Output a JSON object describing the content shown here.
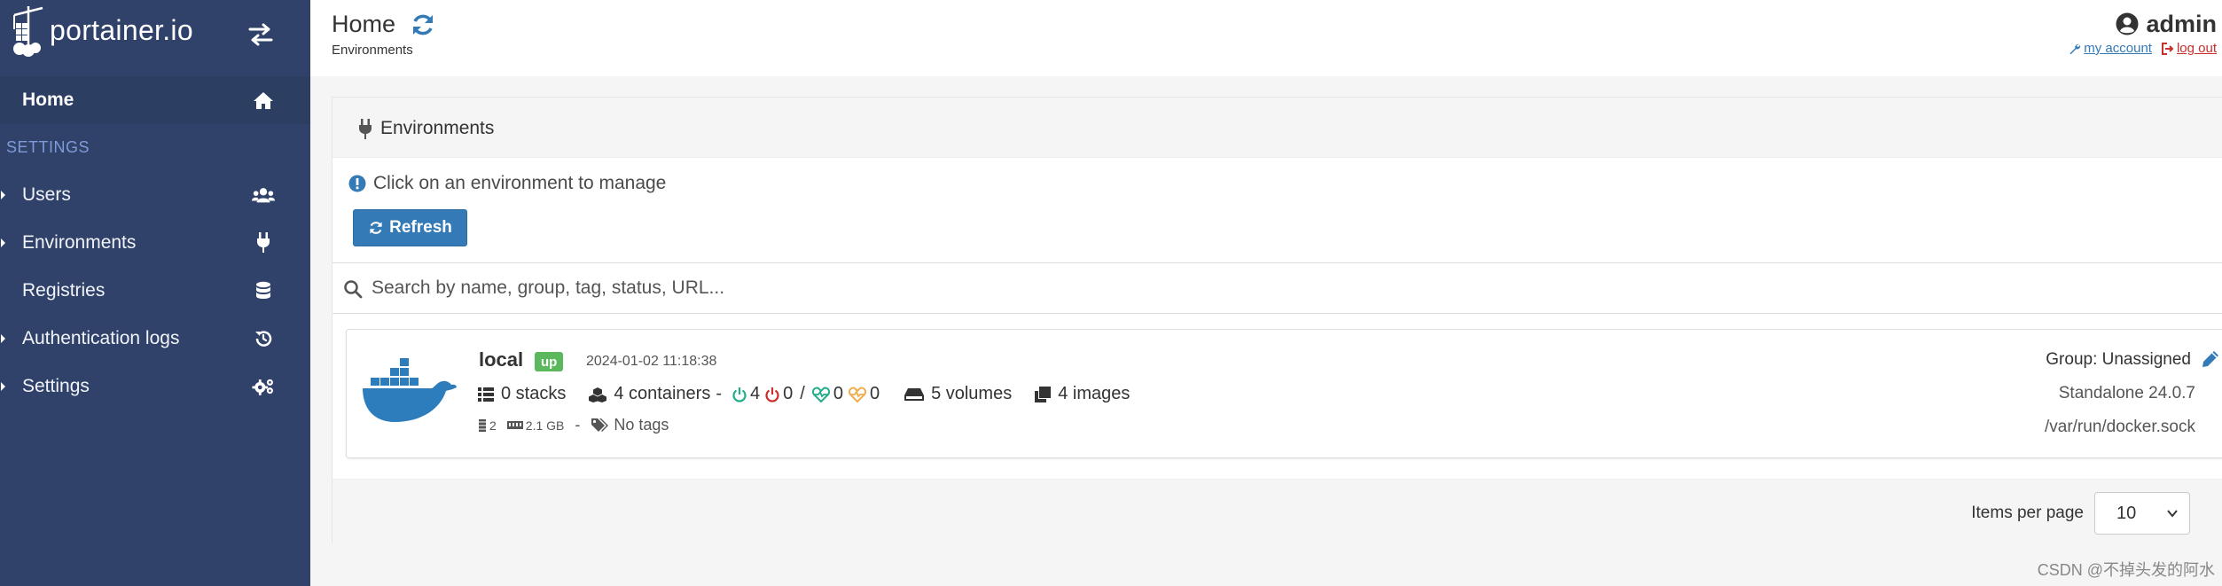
{
  "brand": {
    "name": "portainer.io"
  },
  "sidebar": {
    "home_label": "Home",
    "settings_title": "SETTINGS",
    "items": [
      {
        "label": "Users",
        "icon": "users-icon"
      },
      {
        "label": "Environments",
        "icon": "plug-icon"
      },
      {
        "label": "Registries",
        "icon": "database-icon"
      },
      {
        "label": "Authentication logs",
        "icon": "history-icon"
      },
      {
        "label": "Settings",
        "icon": "gears-icon"
      }
    ]
  },
  "header": {
    "title": "Home",
    "breadcrumb": "Environments",
    "user": "admin",
    "my_account": "my account",
    "log_out": "log out"
  },
  "panel": {
    "title": "Environments",
    "hint": "Click on an environment to manage",
    "refresh_label": "Refresh",
    "search_placeholder": "Search by name, group, tag, status, URL..."
  },
  "environment": {
    "name": "local",
    "status": "up",
    "timestamp": "2024-01-02 11:18:38",
    "stacks": "0 stacks",
    "containers": "4 containers",
    "running": "4",
    "stopped": "0",
    "separator": "/",
    "healthy": "0",
    "unhealthy": "0",
    "volumes": "5 volumes",
    "images": "4 images",
    "cpu": "2",
    "memory": "2.1 GB",
    "tags": "No tags",
    "group": "Group: Unassigned",
    "type": "Standalone 24.0.7",
    "url": "/var/run/docker.sock",
    "colors": {
      "up_badge": "#5cb85c",
      "running": "#23ae89",
      "stopped": "#c9302c",
      "healthy": "#23ae89",
      "unhealthy": "#f0ad4e"
    }
  },
  "pagination": {
    "label": "Items per page",
    "selected": "10"
  },
  "watermark": "CSDN @不掉头发的阿水",
  "theme": {
    "sidebar_bg": "#30426a",
    "accent": "#337ab7"
  }
}
